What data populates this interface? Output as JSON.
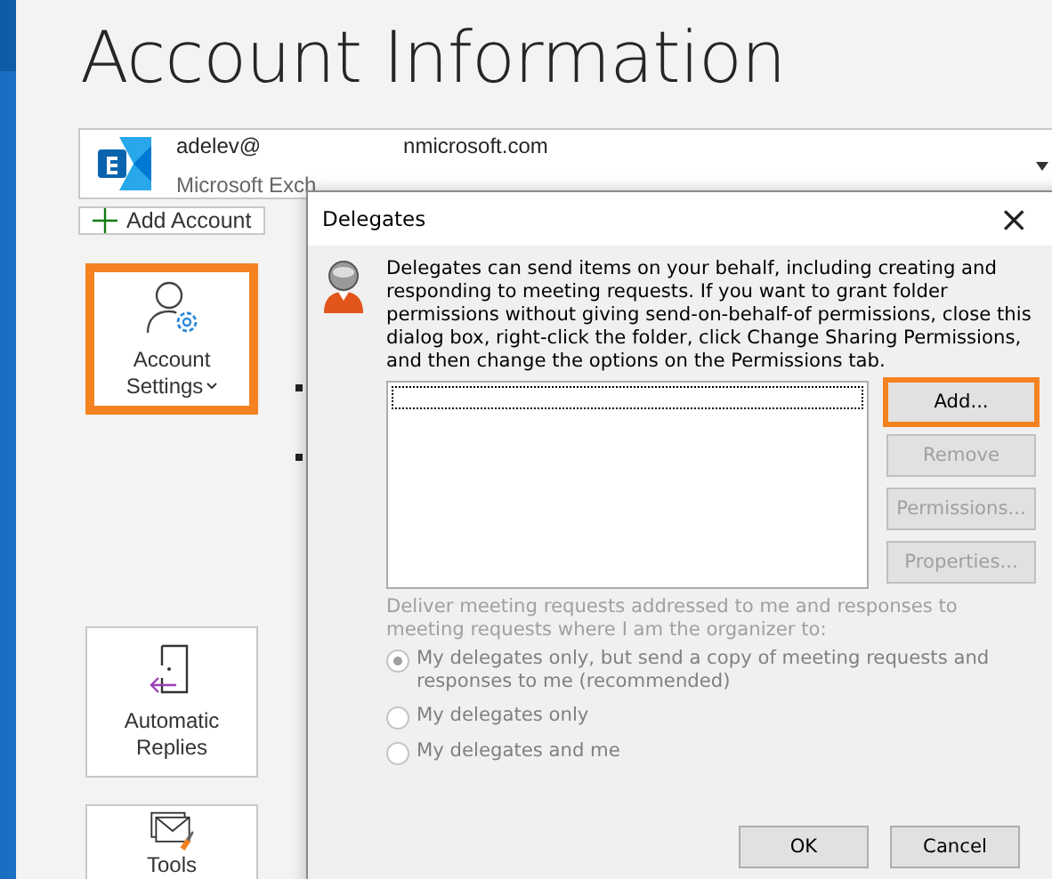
{
  "page_title": "Account Information",
  "account": {
    "email_start": "adelev@",
    "email_end": "nmicrosoft.com",
    "type": "Microsoft Exch"
  },
  "add_account": {
    "label": "Add Account"
  },
  "sections": [
    {
      "kind": "settings",
      "tile_lines": [
        "Account",
        "Settings"
      ],
      "dropdown": true,
      "highlighted": true,
      "lines": [
        {
          "kind": "bullet"
        },
        {
          "kind": "bullet"
        }
      ]
    },
    {
      "kind": "replies",
      "tile_lines": [
        "Automatic",
        "Replies"
      ],
      "dropdown": false,
      "highlighted": false
    },
    {
      "kind": "tools",
      "tile_lines": [
        "Tools"
      ],
      "dropdown": false,
      "highlighted": false
    }
  ],
  "dialog": {
    "title": "Delegates",
    "close": "×",
    "description": "Delegates can send items on your behalf, including creating and responding to meeting requests. If you want to grant folder permissions without giving send-on-behalf-of permissions, close this dialog box, right-click the folder, click Change Sharing Permissions, and then change the options on the Permissions tab.",
    "side_buttons": [
      {
        "label": "Add...",
        "disabled": false,
        "highlighted": true
      },
      {
        "label": "Remove",
        "disabled": true,
        "highlighted": false
      },
      {
        "label": "Permissions...",
        "disabled": true,
        "highlighted": false
      },
      {
        "label": "Properties...",
        "disabled": true,
        "highlighted": false
      }
    ],
    "deliver_label": "Deliver meeting requests addressed to me and responses to meeting requests where I am the organizer to:",
    "deliver_disabled": true,
    "options": [
      {
        "label": "My delegates only, but send a copy of meeting requests and responses to me (recommended)",
        "selected": true,
        "disabled": true
      },
      {
        "label": "My delegates only",
        "selected": false,
        "disabled": true
      },
      {
        "label": "My delegates and me",
        "selected": false,
        "disabled": true
      }
    ],
    "footer_buttons": [
      {
        "label": "OK"
      },
      {
        "label": "Cancel"
      }
    ]
  }
}
